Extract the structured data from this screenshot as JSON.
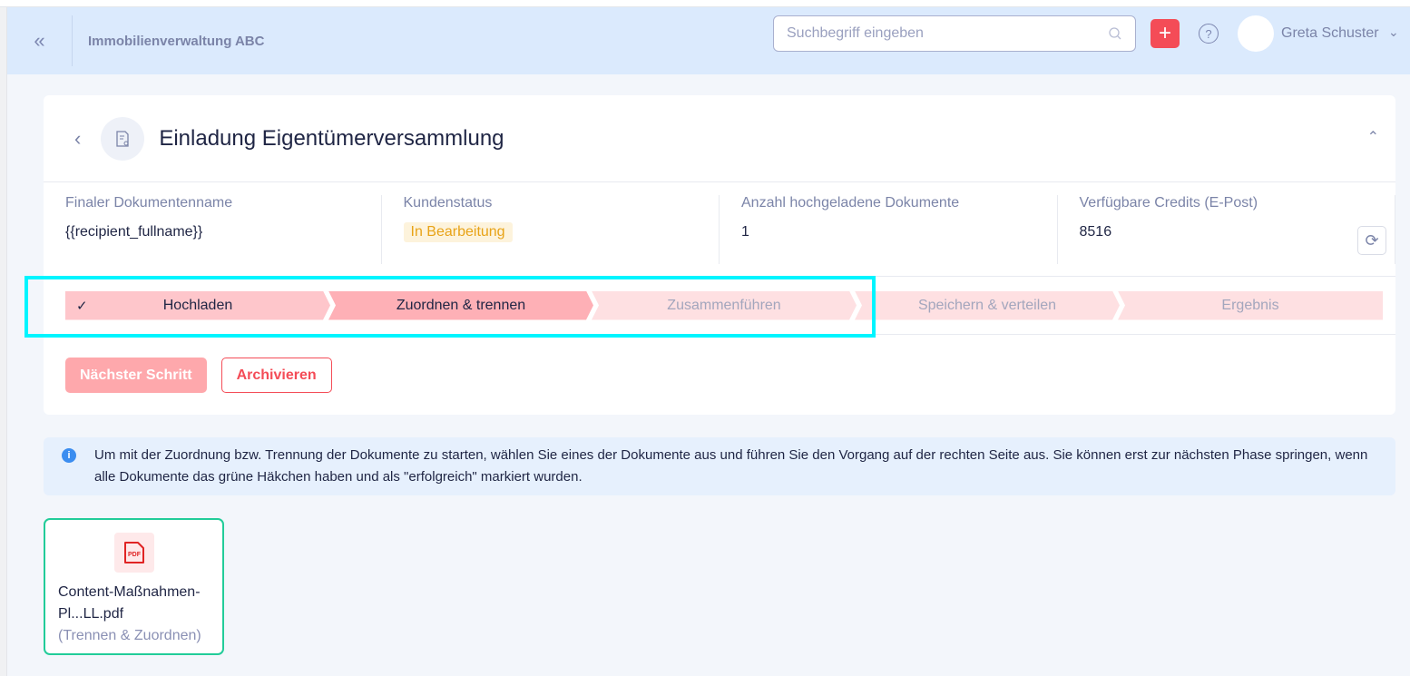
{
  "header": {
    "org": "Immobilienverwaltung ABC",
    "search_placeholder": "Suchbegriff eingeben",
    "user": "Greta Schuster"
  },
  "doc": {
    "title": "Einladung Eigentümerversammlung"
  },
  "info": [
    {
      "label": "Finaler Dokumentenname",
      "value": "{{recipient_fullname}}"
    },
    {
      "label": "Kundenstatus",
      "value": "In Bearbeitung"
    },
    {
      "label": "Anzahl hochgeladene Dokumente",
      "value": "1"
    },
    {
      "label": "Verfügbare Credits (E-Post)",
      "value": "8516"
    }
  ],
  "steps": [
    {
      "label": "Hochladen",
      "state": "done"
    },
    {
      "label": "Zuordnen & trennen",
      "state": "active"
    },
    {
      "label": "Zusammenführen",
      "state": "todo"
    },
    {
      "label": "Speichern & verteilen",
      "state": "todo"
    },
    {
      "label": "Ergebnis",
      "state": "todo"
    }
  ],
  "buttons": {
    "next": "Nächster Schritt",
    "archive": "Archivieren"
  },
  "notice": "Um mit der Zuordnung bzw. Trennung der Dokumente zu starten, wählen Sie eines der Dokumente aus und führen Sie den Vorgang auf der rechten Seite aus. Sie können erst zur nächsten Phase springen, wenn alle Dokumente das grüne Häkchen haben und als \"erfolgreich\" markiert wurden.",
  "file": {
    "name": "Content-Maßnahmen-Pl...LL.pdf",
    "status": "(Trennen & Zuordnen)",
    "icon_text": "PDF"
  }
}
